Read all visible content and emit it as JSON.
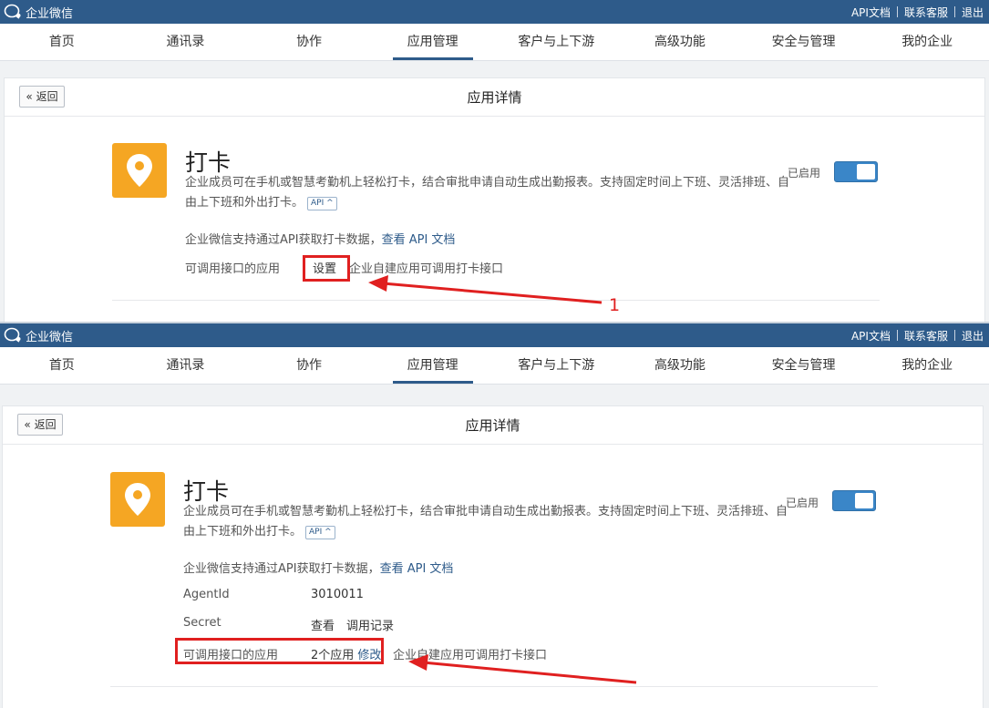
{
  "brand": "企业微信",
  "top_links": [
    "API文档",
    "联系客服",
    "退出"
  ],
  "nav": [
    "首页",
    "通讯录",
    "协作",
    "应用管理",
    "客户与上下游",
    "高级功能",
    "安全与管理",
    "我的企业"
  ],
  "active_nav": "应用管理",
  "page_title": "应用详情",
  "back_label": "返回",
  "app": {
    "name": "打卡",
    "description": "企业成员可在手机或智慧考勤机上轻松打卡，结合审批申请自动生成出勤报表。支持固定时间上下班、灵活排班、自由上下班和外出打卡。",
    "api_tag": "API ^",
    "status": "已启用",
    "enabled": true
  },
  "api_note": {
    "text": "企业微信支持通过API获取打卡数据，",
    "link": "查看 API 文档"
  },
  "shot1": {
    "callable_label": "可调用接口的应用",
    "set_button": "设置",
    "callable_note": "企业自建应用可调用打卡接口",
    "annotation_number": "1"
  },
  "shot2": {
    "agentid_label": "AgentId",
    "agentid_value": "3010011",
    "secret_label": "Secret",
    "secret_view": "查看",
    "secret_log": "调用记录",
    "callable_label": "可调用接口的应用",
    "callable_count": "2个应用",
    "modify_link": "修改",
    "callable_note": "企业自建应用可调用打卡接口"
  },
  "colors": {
    "topbar": "#2e5b8a",
    "accent": "#2e5b8a",
    "app_icon": "#f5a623",
    "toggle": "#3a86c8",
    "annotation": "#e02020"
  }
}
